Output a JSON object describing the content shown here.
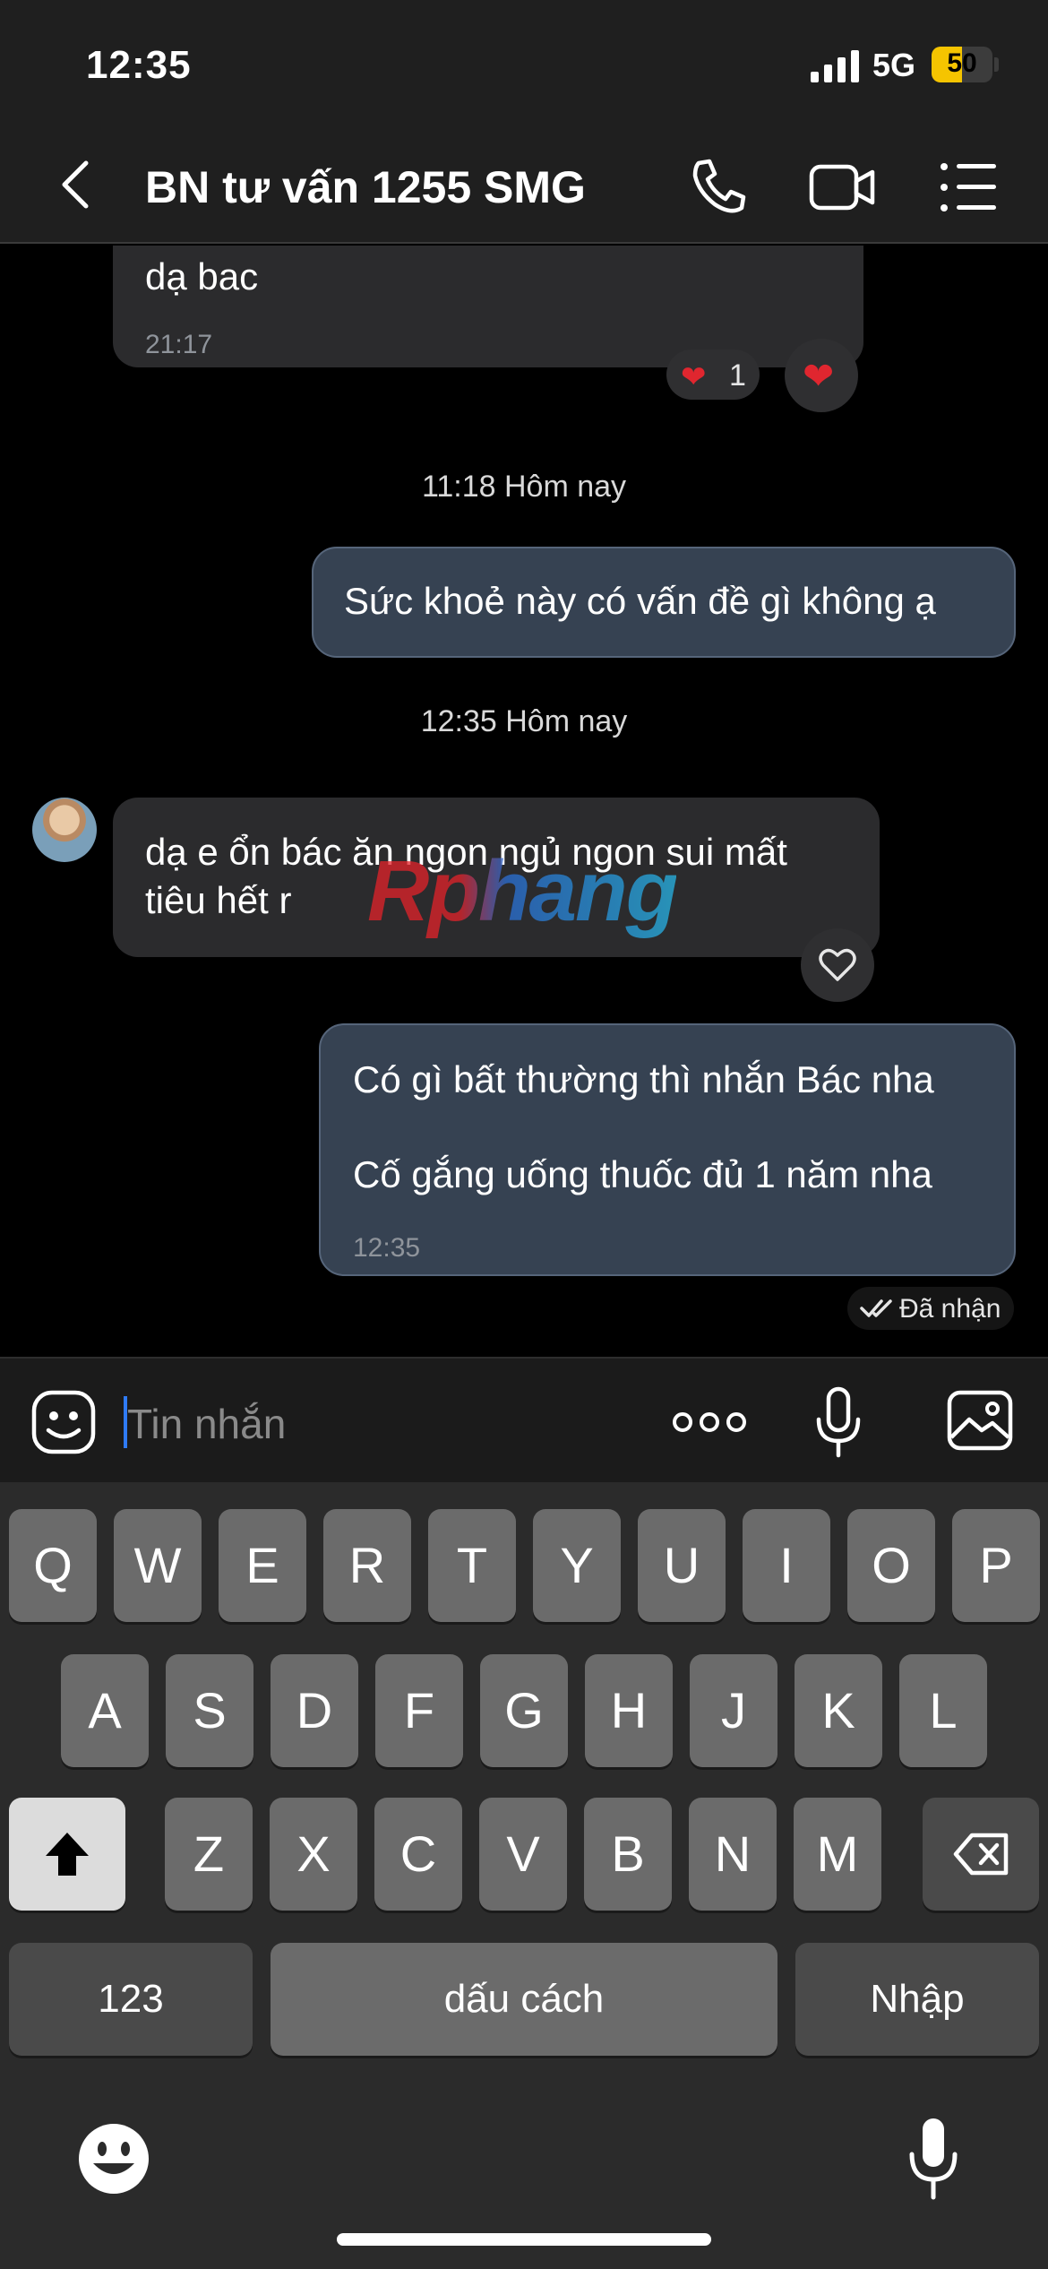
{
  "status_bar": {
    "time": "12:35",
    "network": "5G",
    "battery": "50",
    "battery_level": 0.5
  },
  "header": {
    "title": "BN tư vấn 1255 SMG"
  },
  "messages": {
    "m0": {
      "text": "dạ bac",
      "time": "21:17",
      "reaction_count": "1"
    },
    "sep1": "11:18 Hôm nay",
    "m1": {
      "text": "Sức khoẻ này có vấn đề gì không ạ"
    },
    "sep2": "12:35 Hôm nay",
    "m2": {
      "line1": "dạ e ổn bác ăn ngon ngủ ngon sui mất",
      "line2": "tiêu hết r"
    },
    "m3": {
      "line1": "Có gì bất thường thì nhắn Bác nha",
      "line2": "Cố gắng uống thuốc đủ 1 năm nha",
      "time": "12:35"
    },
    "status": "Đã nhận"
  },
  "watermark": "Rphang",
  "input": {
    "placeholder": "Tin nhắn"
  },
  "keyboard": {
    "row1": [
      "Q",
      "W",
      "E",
      "R",
      "T",
      "Y",
      "U",
      "I",
      "O",
      "P"
    ],
    "row2": [
      "A",
      "S",
      "D",
      "F",
      "G",
      "H",
      "J",
      "K",
      "L"
    ],
    "row3": [
      "Z",
      "X",
      "C",
      "V",
      "B",
      "N",
      "M"
    ],
    "numbers": "123",
    "space": "dấu cách",
    "enter": "Nhập"
  },
  "colors": {
    "accent": "#2f7bf6",
    "out_bubble": "#364252",
    "in_bubble": "#2b2b2d",
    "heart": "#e0262f",
    "battery": "#f5c400"
  }
}
